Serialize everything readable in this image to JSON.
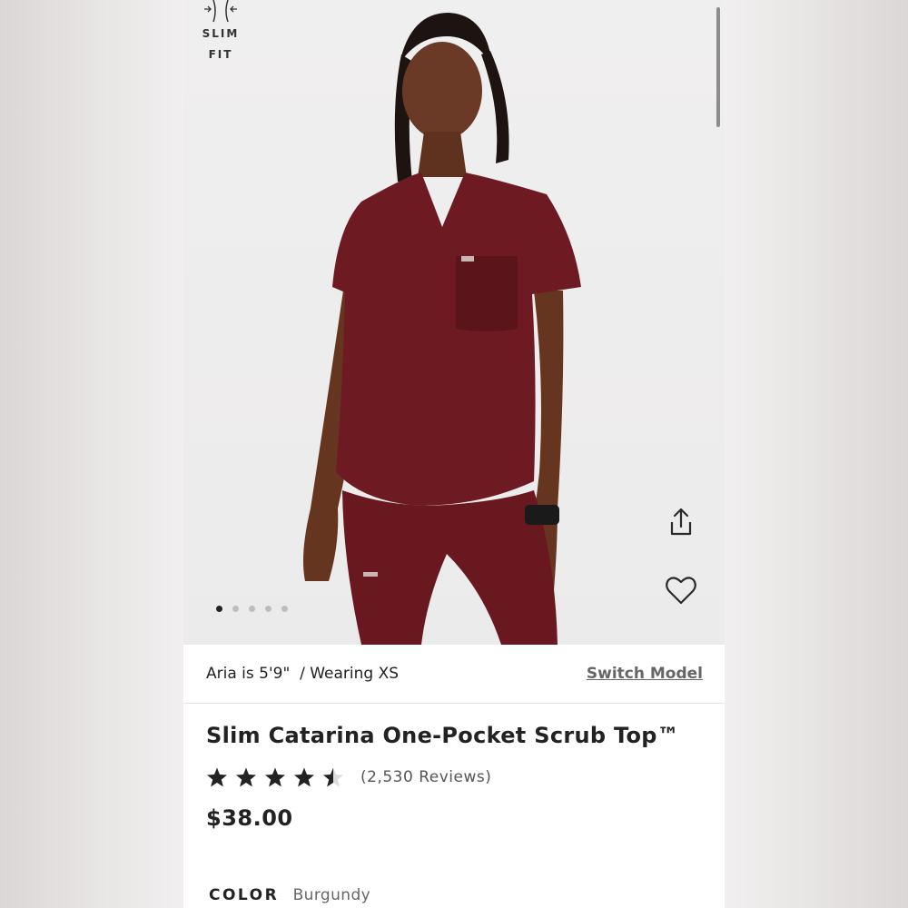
{
  "fit_badge": {
    "line1": "SLIM",
    "line2": "FIT"
  },
  "carousel": {
    "total_images": 5,
    "active_index": 0
  },
  "icons": {
    "share": "share-icon",
    "favorite": "heart-icon",
    "fit": "slim-fit-icon"
  },
  "model_bar": {
    "model_info": "Aria is 5'9\"  / Wearing XS",
    "switch_label": "Switch Model"
  },
  "product": {
    "title": "Slim Catarina One-Pocket Scrub Top™",
    "rating": 4.5,
    "rating_max": 5,
    "reviews_label": "(2,530 Reviews)",
    "price": "$38.00",
    "color_label": "COLOR",
    "color_value": "Burgundy"
  },
  "colors": {
    "garment": "#6e1a22",
    "text": "#222222",
    "muted": "#666666"
  }
}
